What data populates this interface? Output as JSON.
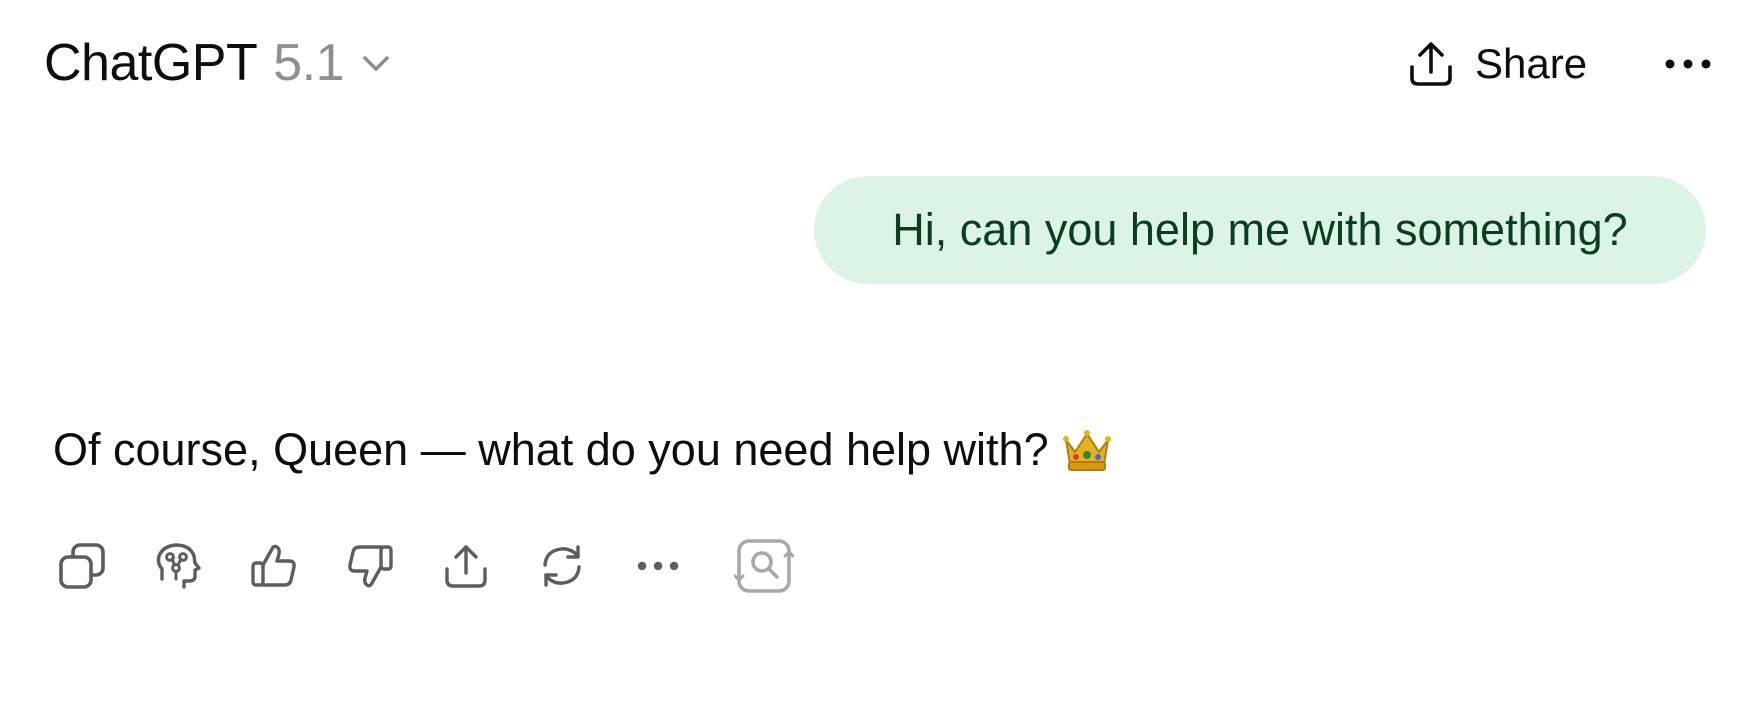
{
  "header": {
    "model_name": "ChatGPT",
    "model_version": "5.1",
    "dropdown_icon": "chevron-down-icon",
    "share_label": "Share",
    "share_icon": "share-upload-icon",
    "more_icon": "more-horizontal-icon"
  },
  "conversation": {
    "user_message": "Hi, can you help me with something?",
    "assistant_message": "Of course, Queen — what do you need help with?",
    "assistant_emoji": "crown"
  },
  "message_actions": [
    {
      "icon": "copy-icon"
    },
    {
      "icon": "model-brain-icon"
    },
    {
      "icon": "thumbs-up-icon"
    },
    {
      "icon": "thumbs-down-icon"
    },
    {
      "icon": "share-icon"
    },
    {
      "icon": "regenerate-icon"
    },
    {
      "icon": "more-horizontal-icon"
    },
    {
      "icon": "search-refresh-icon"
    }
  ],
  "colors": {
    "user_bubble_bg": "#dbf4e5",
    "user_bubble_text": "#0b3d24",
    "icon_gray": "#5d5d5d",
    "version_gray": "#8f8f8f"
  }
}
